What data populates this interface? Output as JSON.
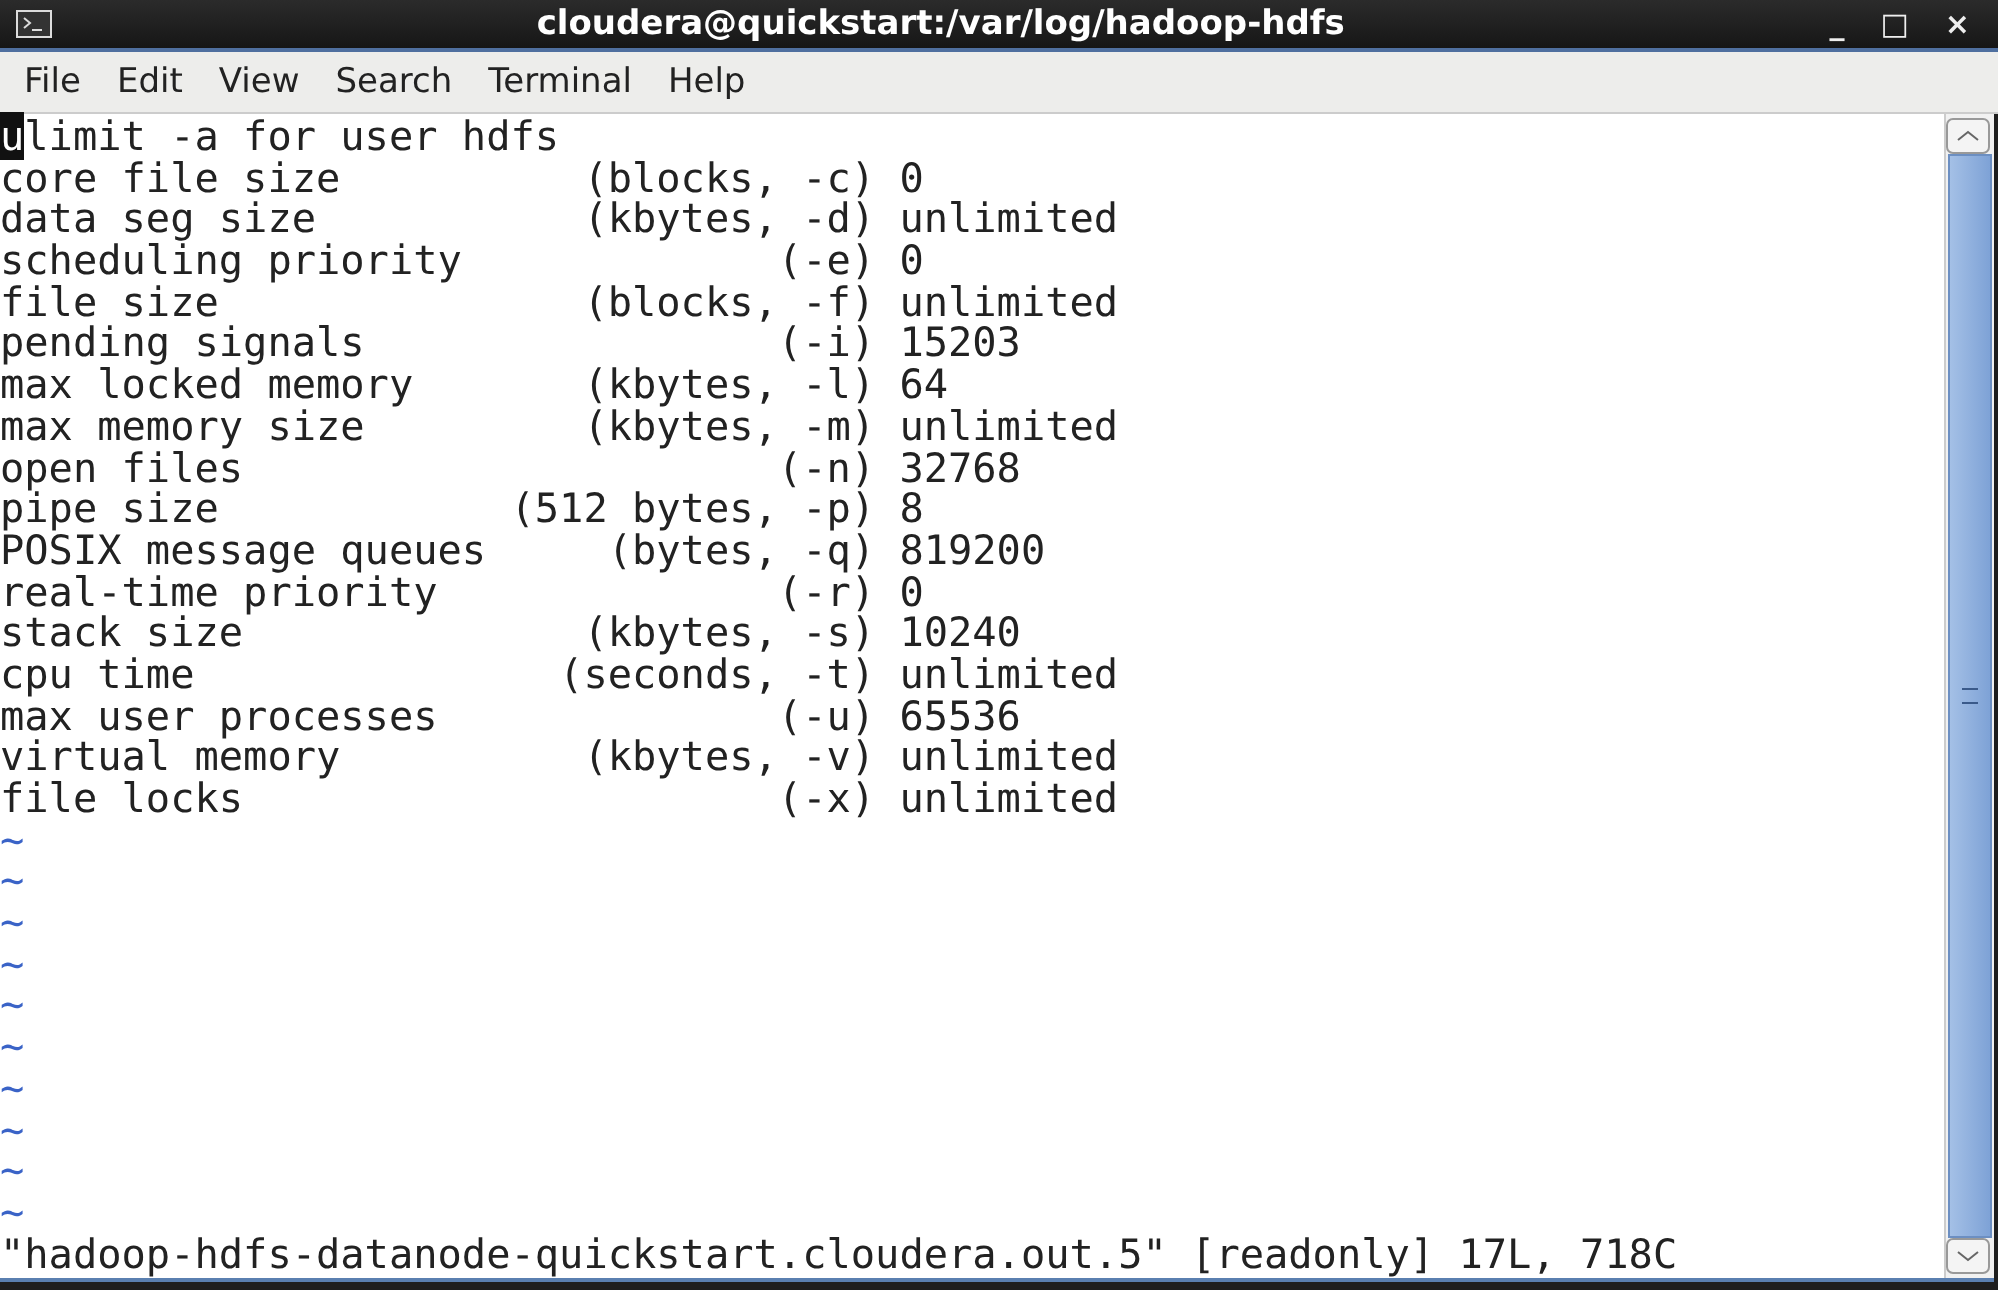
{
  "window": {
    "title": "cloudera@quickstart:/var/log/hadoop-hdfs",
    "controls": [
      "_",
      "□",
      "×"
    ]
  },
  "menu": [
    {
      "label": "File"
    },
    {
      "label": "Edit"
    },
    {
      "label": "View"
    },
    {
      "label": "Search"
    },
    {
      "label": "Terminal"
    },
    {
      "label": "Help"
    }
  ],
  "lines": [
    {
      "kind": "text",
      "cursor": "u",
      "text": "limit -a for user hdfs"
    },
    {
      "kind": "text",
      "text": "core file size          (blocks, -c) 0"
    },
    {
      "kind": "text",
      "text": "data seg size           (kbytes, -d) unlimited"
    },
    {
      "kind": "text",
      "text": "scheduling priority             (-e) 0"
    },
    {
      "kind": "text",
      "text": "file size               (blocks, -f) unlimited"
    },
    {
      "kind": "text",
      "text": "pending signals                 (-i) 15203"
    },
    {
      "kind": "text",
      "text": "max locked memory       (kbytes, -l) 64"
    },
    {
      "kind": "text",
      "text": "max memory size         (kbytes, -m) unlimited"
    },
    {
      "kind": "text",
      "text": "open files                      (-n) 32768"
    },
    {
      "kind": "text",
      "text": "pipe size            (512 bytes, -p) 8"
    },
    {
      "kind": "text",
      "text": "POSIX message queues     (bytes, -q) 819200"
    },
    {
      "kind": "text",
      "text": "real-time priority              (-r) 0"
    },
    {
      "kind": "text",
      "text": "stack size              (kbytes, -s) 10240"
    },
    {
      "kind": "text",
      "text": "cpu time               (seconds, -t) unlimited"
    },
    {
      "kind": "text",
      "text": "max user processes              (-u) 65536"
    },
    {
      "kind": "text",
      "text": "virtual memory          (kbytes, -v) unlimited"
    },
    {
      "kind": "text",
      "text": "file locks                      (-x) unlimited"
    },
    {
      "kind": "tilde",
      "text": "~"
    },
    {
      "kind": "tilde",
      "text": "~"
    },
    {
      "kind": "tilde",
      "text": "~"
    },
    {
      "kind": "tilde",
      "text": "~"
    },
    {
      "kind": "tilde",
      "text": "~"
    },
    {
      "kind": "tilde",
      "text": "~"
    },
    {
      "kind": "tilde",
      "text": "~"
    },
    {
      "kind": "tilde",
      "text": "~"
    },
    {
      "kind": "tilde",
      "text": "~"
    },
    {
      "kind": "tilde",
      "text": "~"
    },
    {
      "kind": "status",
      "text": "\"hadoop-hdfs-datanode-quickstart.cloudera.out.5\" [readonly] 17L, 718C"
    }
  ]
}
